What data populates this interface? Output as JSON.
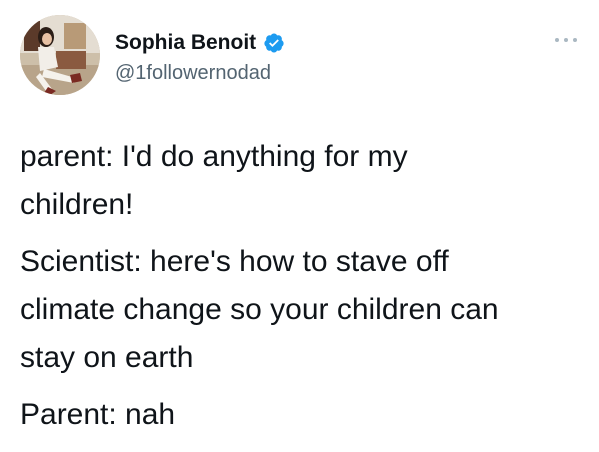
{
  "author": {
    "display_name": "Sophia Benoit",
    "handle": "@1followernodad",
    "verified": true,
    "avatar_icon": "profile-photo-icon"
  },
  "menu": {
    "icon": "more-options-icon"
  },
  "tweet": {
    "paragraphs": [
      "parent: I'd do anything for my\nchildren!",
      "Scientist: here's how to stave off\nclimate change so your children can\nstay on earth",
      "Parent: nah"
    ]
  },
  "colors": {
    "verified_badge": "#1d9bf0",
    "handle_text": "#536471",
    "body_text": "#0f1419"
  }
}
